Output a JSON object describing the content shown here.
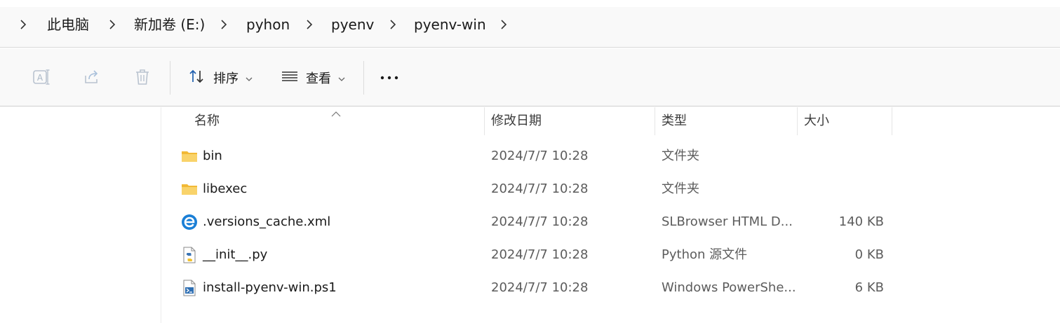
{
  "breadcrumb": {
    "items": [
      "此电脑",
      "新加卷 (E:)",
      "pyhon",
      "pyenv",
      "pyenv-win"
    ]
  },
  "toolbar": {
    "rename_icon": "rename-icon",
    "share_icon": "share-icon",
    "delete_icon": "trash-icon",
    "sort_label": "排序",
    "view_label": "查看",
    "more_icon": "more-icon"
  },
  "columns": {
    "name": "名称",
    "date": "修改日期",
    "type": "类型",
    "size": "大小"
  },
  "files": [
    {
      "name": "bin",
      "date": "2024/7/7 10:28",
      "type": "文件夹",
      "size": "",
      "icon": "folder-icon"
    },
    {
      "name": "libexec",
      "date": "2024/7/7 10:28",
      "type": "文件夹",
      "size": "",
      "icon": "folder-icon"
    },
    {
      "name": ".versions_cache.xml",
      "date": "2024/7/7 10:28",
      "type": "SLBrowser HTML D...",
      "size": "140 KB",
      "icon": "browser-file-icon"
    },
    {
      "name": "__init__.py",
      "date": "2024/7/7 10:28",
      "type": "Python 源文件",
      "size": "0 KB",
      "icon": "python-file-icon"
    },
    {
      "name": "install-pyenv-win.ps1",
      "date": "2024/7/7 10:28",
      "type": "Windows PowerShe...",
      "size": "6 KB",
      "icon": "powershell-file-icon"
    }
  ],
  "colors": {
    "accent": "#1f6fd1",
    "folder": "#f5c542"
  }
}
